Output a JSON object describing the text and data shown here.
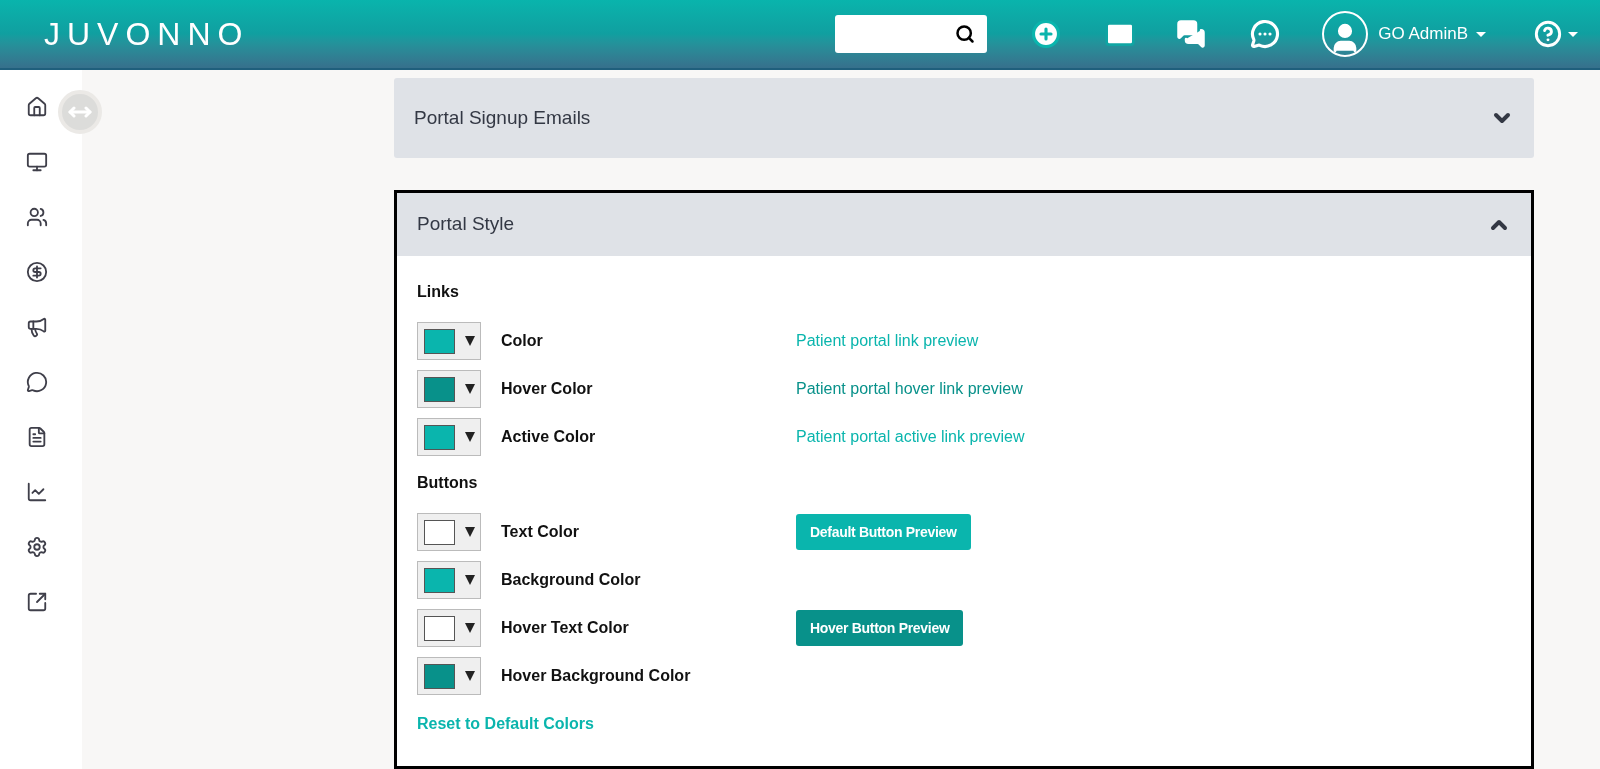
{
  "brand": "JUVONNO",
  "user": {
    "name": "GO AdminB"
  },
  "panels": [
    {
      "title": "Portal Signup Emails",
      "expanded": false
    },
    {
      "title": "Portal Style",
      "expanded": true
    }
  ],
  "sections": [
    {
      "title": "Links",
      "rows": [
        {
          "label": "Color",
          "color": "#0ab5ad",
          "preview": {
            "kind": "link",
            "text": "Patient portal link preview"
          }
        },
        {
          "label": "Hover Color",
          "color": "#08918a",
          "preview": {
            "kind": "link",
            "text": "Patient portal hover link preview"
          }
        },
        {
          "label": "Active Color",
          "color": "#0ab5ad",
          "preview": {
            "kind": "link",
            "text": "Patient portal active link preview"
          }
        }
      ]
    },
    {
      "title": "Buttons",
      "rows": [
        {
          "label": "Text Color",
          "color": "#ffffff",
          "preview": {
            "kind": "button",
            "text": "Default Button Preview"
          }
        },
        {
          "label": "Background Color",
          "color": "#0ab5ad"
        },
        {
          "label": "Hover Text Color",
          "color": "#ffffff",
          "preview": {
            "kind": "button",
            "text": "Hover Button Preview"
          }
        },
        {
          "label": "Hover Background Color",
          "color": "#08918a"
        }
      ]
    }
  ],
  "reset_link": "Reset to Default Colors"
}
